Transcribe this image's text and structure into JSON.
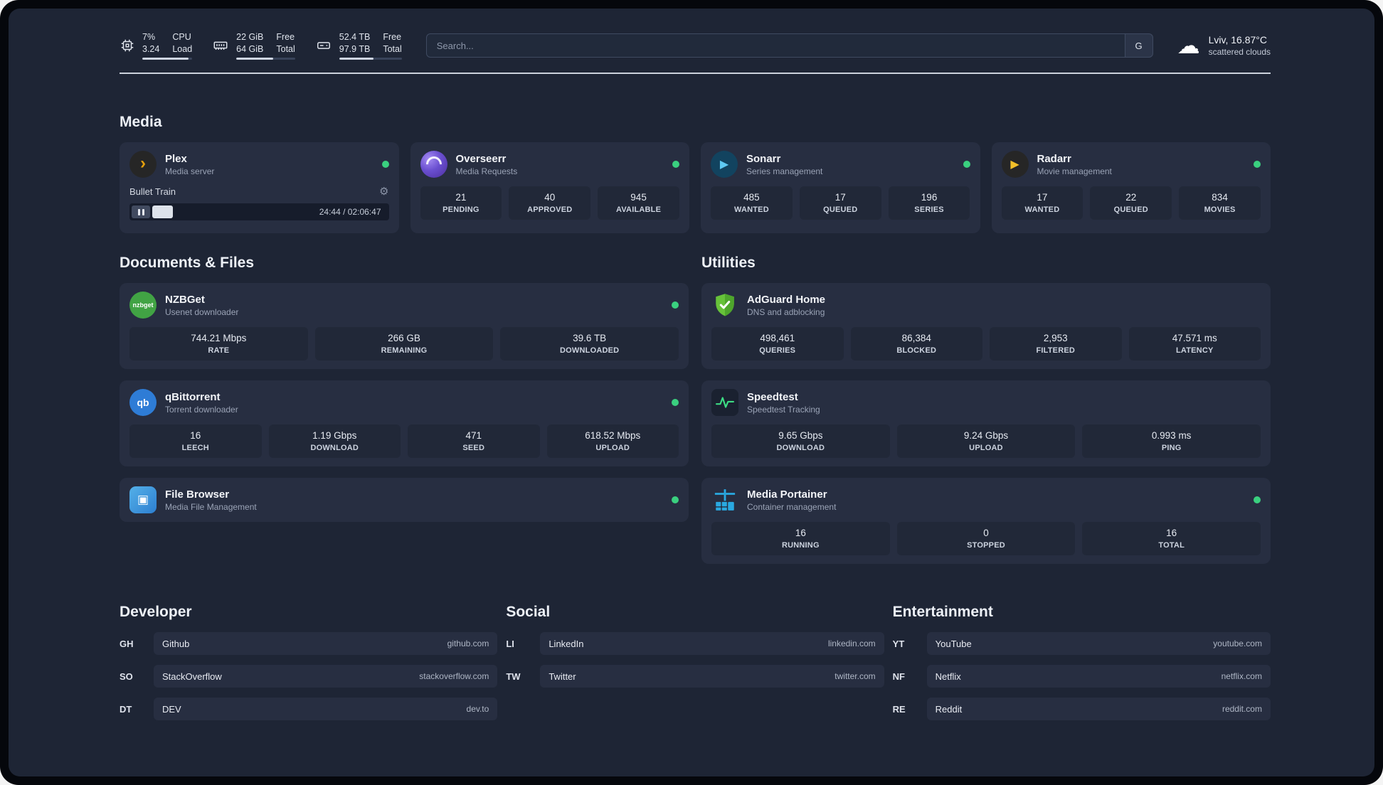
{
  "icons": {
    "cloud": "☁",
    "gear": "⚙",
    "play": "▶",
    "plex_chevron": "›",
    "floppy": "▣"
  },
  "topbar": {
    "cpu": {
      "value1": "7%",
      "value2": "3.24",
      "label1": "CPU",
      "label2": "Load"
    },
    "ram": {
      "value1": "22 GiB",
      "value2": "64 GiB",
      "label1": "Free",
      "label2": "Total"
    },
    "disk": {
      "value1": "52.4 TB",
      "value2": "97.9 TB",
      "label1": "Free",
      "label2": "Total"
    },
    "search": {
      "placeholder": "Search...",
      "engine_button": "G"
    },
    "weather": {
      "location": "Lviv, 16.87°C",
      "condition": "scattered clouds"
    }
  },
  "sections": {
    "media": "Media",
    "documents": "Documents & Files",
    "utilities": "Utilities",
    "developer": "Developer",
    "social": "Social",
    "entertainment": "Entertainment"
  },
  "apps": {
    "plex": {
      "name": "Plex",
      "subtitle": "Media server",
      "now_playing": "Bullet Train",
      "time": "24:44 / 02:06:47"
    },
    "overseerr": {
      "name": "Overseerr",
      "subtitle": "Media Requests",
      "stats": [
        {
          "value": "21",
          "label": "PENDING"
        },
        {
          "value": "40",
          "label": "APPROVED"
        },
        {
          "value": "945",
          "label": "AVAILABLE"
        }
      ]
    },
    "sonarr": {
      "name": "Sonarr",
      "subtitle": "Series management",
      "stats": [
        {
          "value": "485",
          "label": "WANTED"
        },
        {
          "value": "17",
          "label": "QUEUED"
        },
        {
          "value": "196",
          "label": "SERIES"
        }
      ]
    },
    "radarr": {
      "name": "Radarr",
      "subtitle": "Movie management",
      "stats": [
        {
          "value": "17",
          "label": "WANTED"
        },
        {
          "value": "22",
          "label": "QUEUED"
        },
        {
          "value": "834",
          "label": "MOVIES"
        }
      ]
    },
    "nzbget": {
      "name": "NZBGet",
      "subtitle": "Usenet downloader",
      "icon_text": "nzbget",
      "stats": [
        {
          "value": "744.21 Mbps",
          "label": "RATE"
        },
        {
          "value": "266 GB",
          "label": "REMAINING"
        },
        {
          "value": "39.6 TB",
          "label": "DOWNLOADED"
        }
      ]
    },
    "qbittorrent": {
      "name": "qBittorrent",
      "subtitle": "Torrent downloader",
      "icon_text": "qb",
      "stats": [
        {
          "value": "16",
          "label": "LEECH"
        },
        {
          "value": "1.19 Gbps",
          "label": "DOWNLOAD"
        },
        {
          "value": "471",
          "label": "SEED"
        },
        {
          "value": "618.52 Mbps",
          "label": "UPLOAD"
        }
      ]
    },
    "filebrowser": {
      "name": "File Browser",
      "subtitle": "Media File Management"
    },
    "adguard": {
      "name": "AdGuard Home",
      "subtitle": "DNS and adblocking",
      "stats": [
        {
          "value": "498,461",
          "label": "QUERIES"
        },
        {
          "value": "86,384",
          "label": "BLOCKED"
        },
        {
          "value": "2,953",
          "label": "FILTERED"
        },
        {
          "value": "47.571 ms",
          "label": "LATENCY"
        }
      ]
    },
    "speedtest": {
      "name": "Speedtest",
      "subtitle": "Speedtest Tracking",
      "stats": [
        {
          "value": "9.65 Gbps",
          "label": "DOWNLOAD"
        },
        {
          "value": "9.24 Gbps",
          "label": "UPLOAD"
        },
        {
          "value": "0.993 ms",
          "label": "PING"
        }
      ]
    },
    "portainer": {
      "name": "Media Portainer",
      "subtitle": "Container management",
      "stats": [
        {
          "value": "16",
          "label": "RUNNING"
        },
        {
          "value": "0",
          "label": "STOPPED"
        },
        {
          "value": "16",
          "label": "TOTAL"
        }
      ]
    }
  },
  "links": {
    "developer": [
      {
        "abbr": "GH",
        "name": "Github",
        "url": "github.com"
      },
      {
        "abbr": "SO",
        "name": "StackOverflow",
        "url": "stackoverflow.com"
      },
      {
        "abbr": "DT",
        "name": "DEV",
        "url": "dev.to"
      }
    ],
    "social": [
      {
        "abbr": "LI",
        "name": "LinkedIn",
        "url": "linkedin.com"
      },
      {
        "abbr": "TW",
        "name": "Twitter",
        "url": "twitter.com"
      }
    ],
    "entertainment": [
      {
        "abbr": "YT",
        "name": "YouTube",
        "url": "youtube.com"
      },
      {
        "abbr": "NF",
        "name": "Netflix",
        "url": "netflix.com"
      },
      {
        "abbr": "RE",
        "name": "Reddit",
        "url": "reddit.com"
      }
    ]
  },
  "colors": {
    "status_green": "#3ad07f",
    "plex_amber": "#e5a00d",
    "accent_blue": "#29a9e1"
  }
}
